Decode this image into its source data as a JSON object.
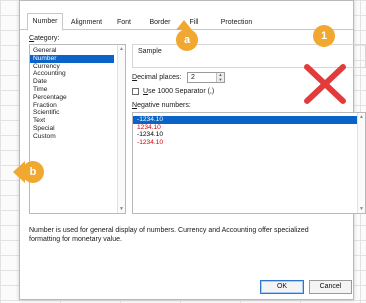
{
  "tabs": [
    {
      "label": "Number",
      "active": true
    },
    {
      "label": "Alignment",
      "active": false
    },
    {
      "label": "Font",
      "active": false
    },
    {
      "label": "Border",
      "active": false
    },
    {
      "label": "Fill",
      "active": false
    },
    {
      "label": "Protection",
      "active": false
    }
  ],
  "category": {
    "label_prefix": "C",
    "label_rest": "ategory:",
    "items": [
      "General",
      "Number",
      "Currency",
      "Accounting",
      "Date",
      "Time",
      "Percentage",
      "Fraction",
      "Scientific",
      "Text",
      "Special",
      "Custom"
    ],
    "selected": "Number"
  },
  "sample": {
    "label": "Sample",
    "value": ""
  },
  "decimal_places": {
    "label_prefix": "D",
    "label_rest": "ecimal places:",
    "value": "2"
  },
  "separator": {
    "label_prefix": "U",
    "label_rest": "se 1000 Separator (,)",
    "checked": false
  },
  "negative_numbers": {
    "label_prefix": "N",
    "label_rest": "egative numbers:",
    "items": [
      {
        "text": "-1234.10",
        "color": "#000000",
        "selected": true
      },
      {
        "text": "1234.10",
        "color": "#d40000",
        "selected": false
      },
      {
        "text": "-1234.10",
        "color": "#000000",
        "selected": false
      },
      {
        "text": "-1234.10",
        "color": "#d40000",
        "selected": false
      }
    ]
  },
  "description": {
    "line1": "Number is used for general display of numbers.  Currency and Accounting offer specialized",
    "line2": "formatting for monetary value."
  },
  "buttons": {
    "ok": "OK",
    "cancel": "Cancel"
  },
  "annotations": {
    "badge_a": "a",
    "badge_b": "b",
    "badge_1": "1",
    "accent_color": "#f0a830",
    "cross_color": "#e23b3b"
  }
}
